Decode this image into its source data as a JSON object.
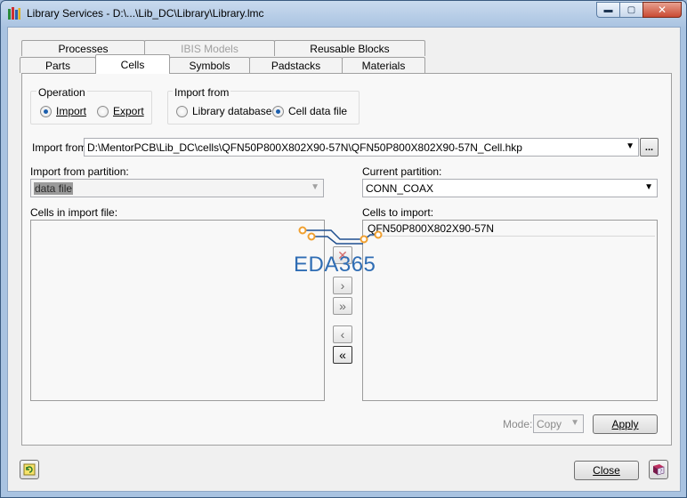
{
  "window": {
    "title": "Library Services - D:\\...\\Lib_DC\\Library\\Library.lmc",
    "controls": {
      "minimize": "▬",
      "maximize": "▢",
      "close": "✕"
    }
  },
  "tabs": {
    "row_back": [
      "Processes",
      "IBIS Models",
      "Reusable Blocks"
    ],
    "row_front": [
      "Parts",
      "Cells",
      "Symbols",
      "Padstacks",
      "Materials"
    ],
    "active": "Cells"
  },
  "operation": {
    "title": "Operation",
    "options": [
      "Import",
      "Export"
    ],
    "selected": "Import"
  },
  "import_from_group": {
    "title": "Import from",
    "options": [
      "Library database",
      "Cell data file"
    ],
    "selected": "Cell data file"
  },
  "import_path": {
    "label": "Import from:",
    "value": "D:\\MentorPCB\\Lib_DC\\cells\\QFN50P800X802X90-57N\\QFN50P800X802X90-57N_Cell.hkp",
    "browse_label": "..."
  },
  "import_partition": {
    "label": "Import from partition:",
    "value": "data file"
  },
  "current_partition": {
    "label": "Current partition:",
    "value": "CONN_COAX"
  },
  "cells_in_file": {
    "label": "Cells in import file:",
    "items": []
  },
  "cells_to_import": {
    "label": "Cells to import:",
    "items": [
      "QFN50P800X802X90-57N"
    ]
  },
  "move_buttons": {
    "delete": "✕",
    "add": "›",
    "add_all": "»",
    "remove": "‹",
    "remove_all": "«"
  },
  "mode": {
    "label": "Mode:",
    "value": "Copy"
  },
  "buttons": {
    "apply": "Apply",
    "close": "Close"
  },
  "watermark": {
    "text": "EDA365",
    "color": "#2f6db4"
  },
  "icons": [
    "library-app-icon",
    "refresh-icon",
    "help-book-icon",
    "dropdown-arrow-icon"
  ],
  "colors": {
    "accent": "#1c5fae",
    "watermark_dots": "#f0a030"
  }
}
